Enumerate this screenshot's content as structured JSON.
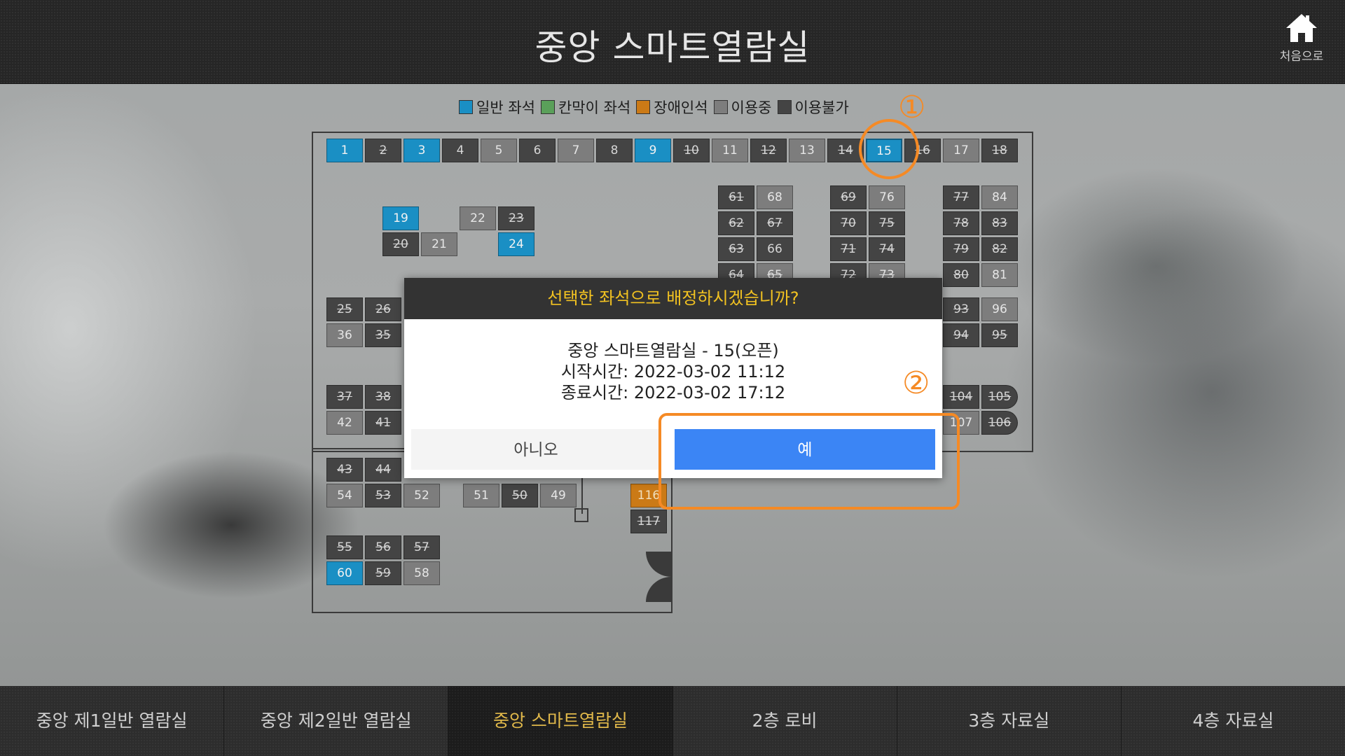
{
  "header": {
    "title": "중앙 스마트열람실",
    "home_label": "처음으로"
  },
  "legend": [
    {
      "label": "일반 좌석",
      "color": "#1a8fc4"
    },
    {
      "label": "칸막이 좌석",
      "color": "#5aa05a"
    },
    {
      "label": "장애인석",
      "color": "#cb7a16"
    },
    {
      "label": "이용중",
      "color": "#7d7d7d"
    },
    {
      "label": "이용불가",
      "color": "#444444"
    }
  ],
  "annotations": {
    "mark1": "①",
    "mark2": "②"
  },
  "seats": {
    "s1": "1",
    "s2": "2",
    "s3": "3",
    "s4": "4",
    "s5": "5",
    "s6": "6",
    "s7": "7",
    "s8": "8",
    "s9": "9",
    "s10": "10",
    "s11": "11",
    "s12": "12",
    "s13": "13",
    "s14": "14",
    "s15": "15",
    "s16": "16",
    "s17": "17",
    "s18": "18",
    "s19": "19",
    "s20": "20",
    "s21": "21",
    "s22": "22",
    "s23": "23",
    "s24": "24",
    "s25": "25",
    "s26": "26",
    "s35": "35",
    "s36": "36",
    "s37": "37",
    "s38": "38",
    "s41": "41",
    "s42": "42",
    "s43": "43",
    "s44": "44",
    "s49": "49",
    "s50": "50",
    "s51": "51",
    "s52": "52",
    "s53": "53",
    "s54": "54",
    "s55": "55",
    "s56": "56",
    "s57": "57",
    "s58": "58",
    "s59": "59",
    "s60": "60",
    "s61": "61",
    "s62": "62",
    "s63": "63",
    "s64": "64",
    "s65": "65",
    "s66": "66",
    "s67": "67",
    "s68": "68",
    "s69": "69",
    "s70": "70",
    "s71": "71",
    "s72": "72",
    "s73": "73",
    "s74": "74",
    "s75": "75",
    "s76": "76",
    "s77": "77",
    "s78": "78",
    "s79": "79",
    "s80": "80",
    "s81": "81",
    "s82": "82",
    "s83": "83",
    "s84": "84",
    "s93": "93",
    "s94": "94",
    "s95": "95",
    "s96": "96",
    "s104": "104",
    "s105": "105",
    "s106": "106",
    "s107": "107",
    "s116": "116",
    "s117": "117"
  },
  "modal": {
    "title": "선택한 좌석으로 배정하시겠습니까?",
    "line1": "중앙 스마트열람실 - 15(오픈)",
    "line2": "시작시간: 2022-03-02 11:12",
    "line3": "종료시간: 2022-03-02 17:12",
    "no_label": "아니오",
    "yes_label": "예"
  },
  "tabs": [
    {
      "label": "중앙 제1일반 열람실"
    },
    {
      "label": "중앙 제2일반 열람실"
    },
    {
      "label": "중앙 스마트열람실",
      "active": true
    },
    {
      "label": "2층 로비"
    },
    {
      "label": "3층 자료실"
    },
    {
      "label": "4층 자료실"
    }
  ]
}
